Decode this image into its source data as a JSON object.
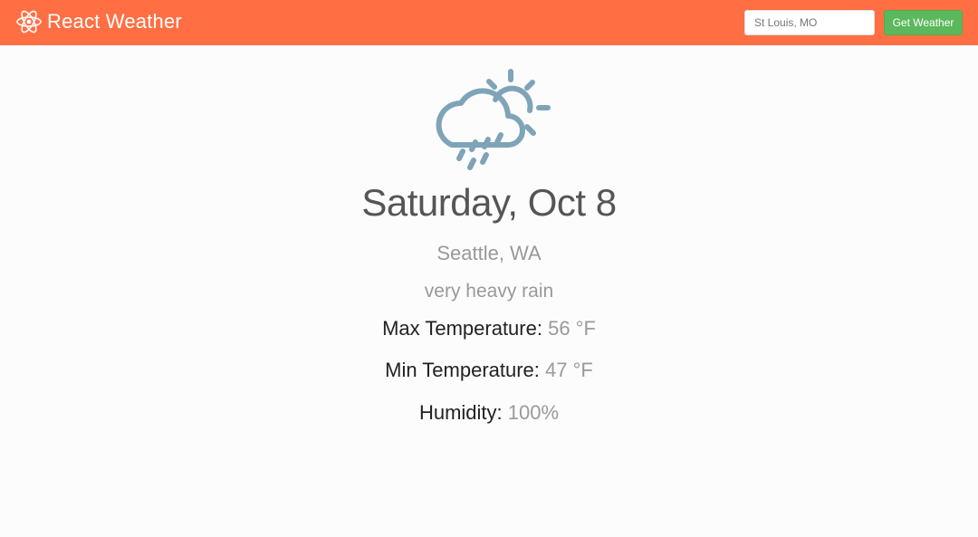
{
  "navbar": {
    "brand_title": "React Weather",
    "brand_icon": "react-atom-icon",
    "search_placeholder": "St Louis, MO",
    "search_value": "",
    "submit_label": "Get Weather",
    "background_color": "#ff6f43",
    "button_color": "#5cb85c"
  },
  "forecast": {
    "icon": "rain-cloud-sun-icon",
    "icon_color": "#7fa4b8",
    "date": "Saturday, Oct 8",
    "city": "Seattle, WA",
    "description": "very heavy rain",
    "max_label": "Max Temperature:",
    "max_value": "56 °F",
    "min_label": "Min Temperature:",
    "min_value": "47 °F",
    "humidity_label": "Humidity:",
    "humidity_value": "100%"
  }
}
